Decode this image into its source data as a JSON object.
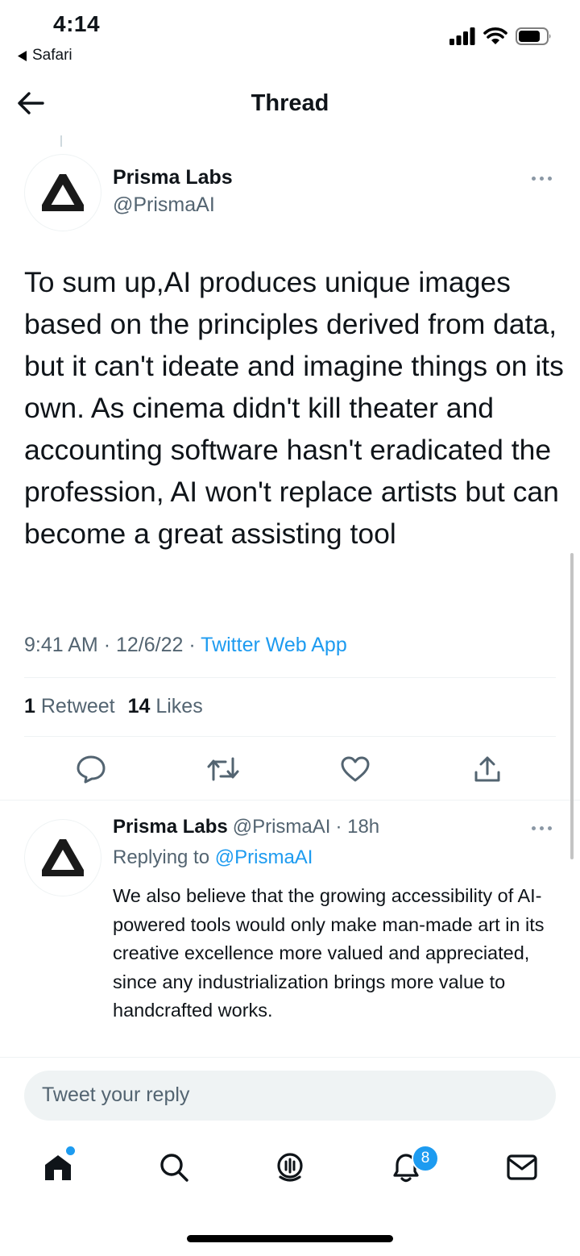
{
  "status_bar": {
    "time": "4:14",
    "back_app": "Safari",
    "icons": [
      "signal-icon",
      "wifi-icon",
      "battery-icon"
    ]
  },
  "nav": {
    "title": "Thread",
    "back_icon": "arrow-left-icon"
  },
  "main_tweet": {
    "author_name": "Prisma Labs",
    "author_handle": "@PrismaAI",
    "text": "To sum up,AI produces unique images based on the principles derived from data, but it can't ideate and imagine things on its own. As cinema didn't kill theater and accounting software hasn't eradicated the profession, AI won't replace artists but can become a great assisting tool",
    "time": "9:41 AM",
    "date": "12/6/22",
    "separator": "·",
    "source": "Twitter Web App",
    "retweets_count": "1",
    "retweets_label": "Retweet",
    "likes_count": "14",
    "likes_label": "Likes",
    "actions": [
      "reply-icon",
      "retweet-icon",
      "like-icon",
      "share-icon"
    ]
  },
  "reply_tweet": {
    "author_name": "Prisma Labs",
    "author_handle": "@PrismaAI",
    "age": "· 18h",
    "replying_label": "Replying to",
    "replying_to": "@PrismaAI",
    "text": "We also believe that the growing accessibility of AI-powered tools would only make man-made art in its creative excellence more valued and appreciated, since any industrialization brings more value to handcrafted works."
  },
  "compose": {
    "placeholder": "Tweet your reply"
  },
  "tab_bar": {
    "tabs": [
      "home-icon",
      "search-icon",
      "spaces-icon",
      "notifications-icon",
      "messages-icon"
    ],
    "notifications_badge": "8"
  },
  "colors": {
    "accent": "#1d9bf0",
    "text": "#0f1419",
    "muted": "#536471",
    "divider": "#eff3f4"
  }
}
